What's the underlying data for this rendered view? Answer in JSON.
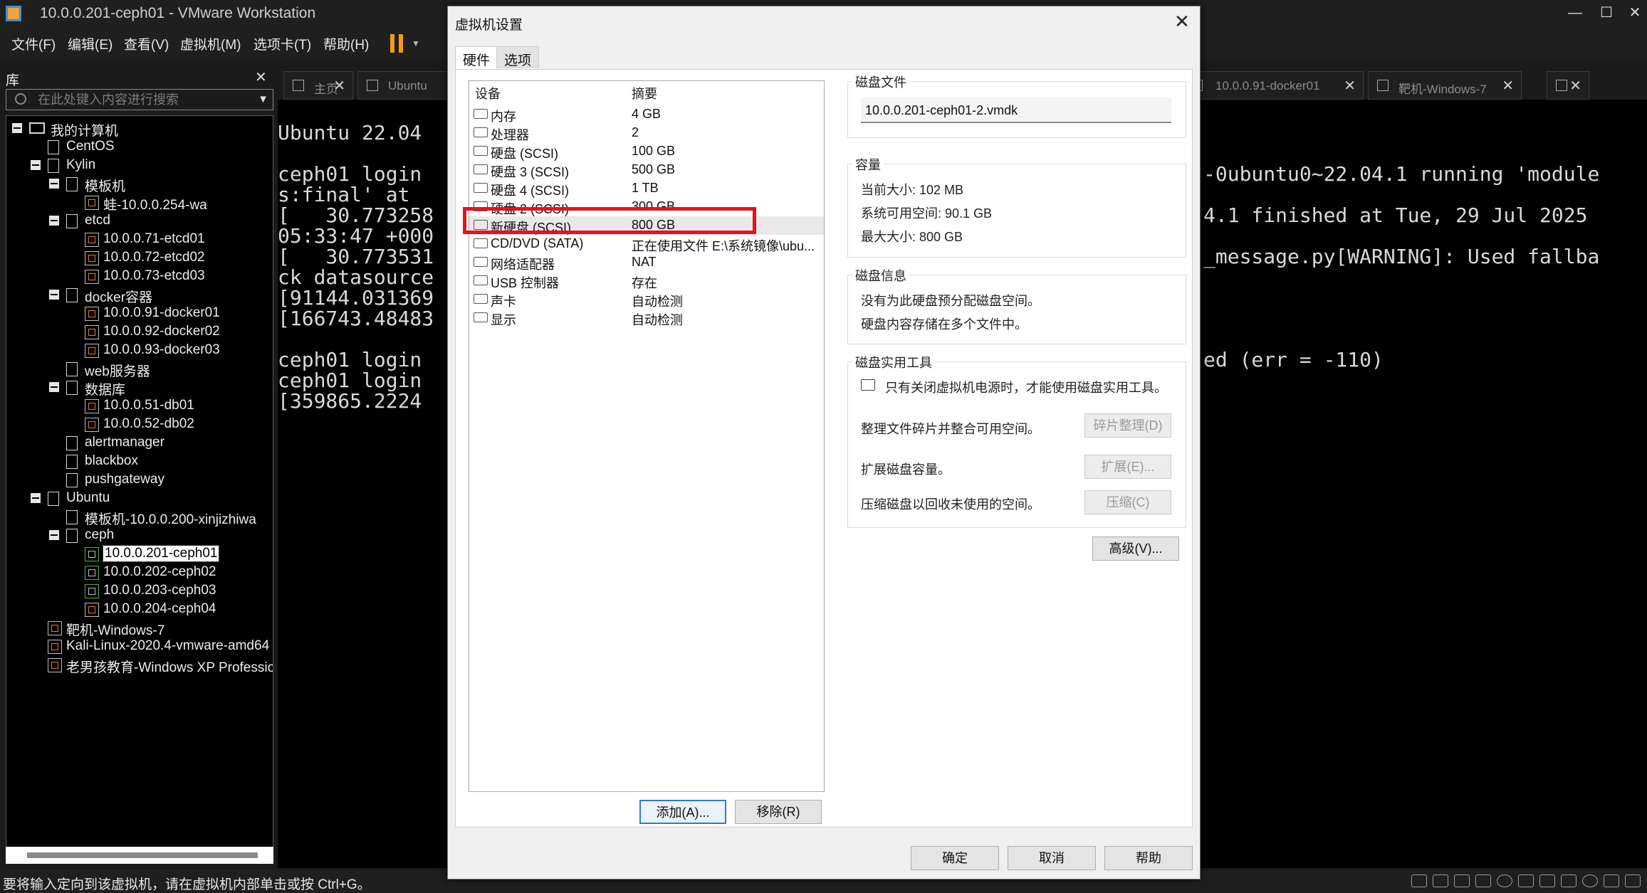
{
  "window": {
    "title": "10.0.0.201-ceph01 - VMware Workstation",
    "minimize": "—",
    "maximize": "☐",
    "close": "✕"
  },
  "menu": [
    "文件(F)",
    "编辑(E)",
    "查看(V)",
    "虚拟机(M)",
    "选项卡(T)",
    "帮助(H)"
  ],
  "library": {
    "title": "库",
    "close": "✕",
    "search_placeholder": "在此处键入内容进行搜索",
    "tree": [
      {
        "label": "我的计算机",
        "level": 0,
        "expand": true,
        "icon": "computer-icon"
      },
      {
        "label": "CentOS",
        "level": 1,
        "expand": false,
        "icon": "folder-icon"
      },
      {
        "label": "Kylin",
        "level": 1,
        "expand": true,
        "icon": "folder-icon"
      },
      {
        "label": "模板机",
        "level": 2,
        "expand": true,
        "icon": "folder-icon"
      },
      {
        "label": "蛙-10.0.0.254-wa",
        "level": 3,
        "expand": false,
        "icon": "vm-icon"
      },
      {
        "label": "etcd",
        "level": 2,
        "expand": true,
        "icon": "folder-icon"
      },
      {
        "label": "10.0.0.71-etcd01",
        "level": 3,
        "expand": false,
        "icon": "vm-icon"
      },
      {
        "label": "10.0.0.72-etcd02",
        "level": 3,
        "expand": false,
        "icon": "vm-icon"
      },
      {
        "label": "10.0.0.73-etcd03",
        "level": 3,
        "expand": false,
        "icon": "vm-icon"
      },
      {
        "label": "docker容器",
        "level": 2,
        "expand": true,
        "icon": "folder-icon"
      },
      {
        "label": "10.0.0.91-docker01",
        "level": 3,
        "expand": false,
        "icon": "vm-icon"
      },
      {
        "label": "10.0.0.92-docker02",
        "level": 3,
        "expand": false,
        "icon": "vm-icon"
      },
      {
        "label": "10.0.0.93-docker03",
        "level": 3,
        "expand": false,
        "icon": "vm-icon"
      },
      {
        "label": "web服务器",
        "level": 2,
        "expand": false,
        "icon": "folder-icon"
      },
      {
        "label": "数据库",
        "level": 2,
        "expand": true,
        "icon": "folder-icon"
      },
      {
        "label": "10.0.0.51-db01",
        "level": 3,
        "expand": false,
        "icon": "vm-icon"
      },
      {
        "label": "10.0.0.52-db02",
        "level": 3,
        "expand": false,
        "icon": "vm-icon"
      },
      {
        "label": "alertmanager",
        "level": 2,
        "expand": false,
        "icon": "folder-icon"
      },
      {
        "label": "blackbox",
        "level": 2,
        "expand": false,
        "icon": "folder-icon"
      },
      {
        "label": "pushgateway",
        "level": 2,
        "expand": false,
        "icon": "folder-icon"
      },
      {
        "label": "Ubuntu",
        "level": 1,
        "expand": true,
        "icon": "folder-icon"
      },
      {
        "label": "模板机-10.0.0.200-xinjizhiwa",
        "level": 2,
        "expand": false,
        "icon": "folder-icon"
      },
      {
        "label": "ceph",
        "level": 2,
        "expand": true,
        "icon": "folder-icon"
      },
      {
        "label": "10.0.0.201-ceph01",
        "level": 3,
        "expand": false,
        "icon": "vm-running-icon",
        "selected": true
      },
      {
        "label": "10.0.0.202-ceph02",
        "level": 3,
        "expand": false,
        "icon": "vm-running-icon"
      },
      {
        "label": "10.0.0.203-ceph03",
        "level": 3,
        "expand": false,
        "icon": "vm-running-icon"
      },
      {
        "label": "10.0.0.204-ceph04",
        "level": 3,
        "expand": false,
        "icon": "vm-icon"
      },
      {
        "label": "靶机-Windows-7",
        "level": 1,
        "expand": false,
        "icon": "vm-icon"
      },
      {
        "label": "Kali-Linux-2020.4-vmware-amd64",
        "level": 1,
        "expand": false,
        "icon": "vm-icon"
      },
      {
        "label": "老男孩教育-Windows XP Professional",
        "level": 1,
        "expand": false,
        "icon": "vm-icon"
      }
    ]
  },
  "tabs": [
    {
      "label": "主页",
      "icon": "home-icon"
    },
    {
      "label": "Ubuntu",
      "icon": "vm-icon"
    },
    {
      "label": "10.0.0.91-docker01",
      "icon": "vm-icon"
    },
    {
      "label": "靶机-Windows-7",
      "icon": "vm-icon"
    },
    {
      "label": "",
      "icon": "vm-icon"
    }
  ],
  "console": {
    "left_lines": [
      "Ubuntu 22.04",
      "",
      "ceph01 login",
      "s:final' at",
      "[   30.773258",
      "05:33:47 +000",
      "[   30.773531",
      "ck datasource",
      "[91144.031369",
      "[166743.48483",
      "",
      "ceph01 login",
      "ceph01 login",
      "[359865.2224"
    ],
    "right_lines": [
      {
        "row": 2,
        "text": "-0ubuntu0~22.04.1 running 'module"
      },
      {
        "row": 4,
        "text": "4.1 finished at Tue, 29 Jul 2025"
      },
      {
        "row": 6,
        "text": "_message.py[WARNING]: Used fallba"
      },
      {
        "row": 11,
        "text": "ed (err = -110)"
      }
    ]
  },
  "statusbar": {
    "message": "要将输入定向到该虚拟机，请在虚拟机内部单击或按 Ctrl+G。"
  },
  "dialog": {
    "title": "虚拟机设置",
    "close": "✕",
    "tabs": [
      "硬件",
      "选项"
    ],
    "device_header": {
      "device": "设备",
      "summary": "摘要"
    },
    "devices": [
      {
        "name": "内存",
        "summary": "4 GB",
        "icon": "memory-icon"
      },
      {
        "name": "处理器",
        "summary": "2",
        "icon": "cpu-icon"
      },
      {
        "name": "硬盘 (SCSI)",
        "summary": "100 GB",
        "icon": "disk-icon"
      },
      {
        "name": "硬盘 3 (SCSI)",
        "summary": "500 GB",
        "icon": "disk-icon"
      },
      {
        "name": "硬盘 4 (SCSI)",
        "summary": "1 TB",
        "icon": "disk-icon"
      },
      {
        "name": "硬盘 2 (SCSI)",
        "summary": "300 GB",
        "icon": "disk-icon"
      },
      {
        "name": "新硬盘 (SCSI)",
        "summary": "800 GB",
        "icon": "disk-icon",
        "selected": true
      },
      {
        "name": "CD/DVD (SATA)",
        "summary": "正在使用文件 E:\\系统镜像\\ubu...",
        "icon": "cdrom-icon"
      },
      {
        "name": "网络适配器",
        "summary": "NAT",
        "icon": "network-icon"
      },
      {
        "name": "USB 控制器",
        "summary": "存在",
        "icon": "usb-icon"
      },
      {
        "name": "声卡",
        "summary": "自动检测",
        "icon": "speaker-icon"
      },
      {
        "name": "显示",
        "summary": "自动检测",
        "icon": "monitor-icon"
      }
    ],
    "add_button": "添加(A)...",
    "remove_button": "移除(R)",
    "disk_file": {
      "title": "磁盘文件",
      "value": "10.0.0.201-ceph01-2.vmdk"
    },
    "capacity": {
      "title": "容量",
      "current": "当前大小: 102 MB",
      "available": "系统可用空间: 90.1 GB",
      "max": "最大大小: 800 GB"
    },
    "disk_info": {
      "title": "磁盘信息",
      "line1": "没有为此硬盘预分配磁盘空间。",
      "line2": "硬盘内容存储在多个文件中。"
    },
    "utilities": {
      "title": "磁盘实用工具",
      "note": "只有关闭虚拟机电源时，才能使用磁盘实用工具。",
      "defrag_text": "整理文件碎片并整合可用空间。",
      "defrag_button": "碎片整理(D)",
      "expand_text": "扩展磁盘容量。",
      "expand_button": "扩展(E)...",
      "compact_text": "压缩磁盘以回收未使用的空间。",
      "compact_button": "压缩(C)"
    },
    "advanced_button": "高级(V)...",
    "ok_button": "确定",
    "cancel_button": "取消",
    "help_button": "帮助"
  },
  "colors": {
    "highlight_box": "#e8121c",
    "pause_icon": "#f39a1e",
    "running_vm": "#46b050"
  }
}
